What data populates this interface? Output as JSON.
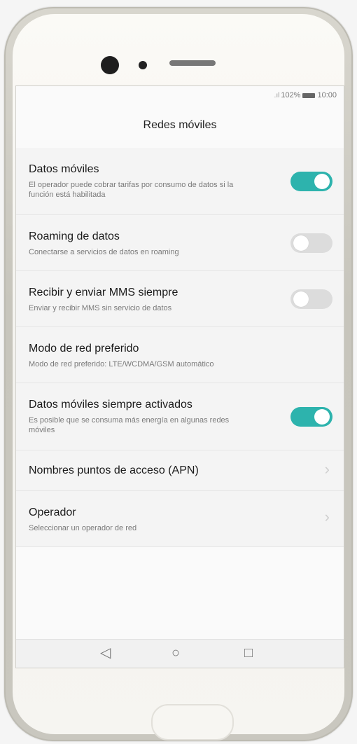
{
  "status_bar": {
    "signal": "…⊿",
    "battery_percent": "102%",
    "time": "10:00"
  },
  "screen_title": "Redes móviles",
  "settings": [
    {
      "title": "Datos móviles",
      "subtitle": "El operador puede cobrar tarifas por consumo de datos si la función está habilitada",
      "toggle": "on"
    },
    {
      "title": "Roaming de datos",
      "subtitle": "Conectarse a servicios de datos en roaming",
      "toggle": "off"
    },
    {
      "title": "Recibir y enviar MMS siempre",
      "subtitle": "Enviar y recibir MMS sin servicio de datos",
      "toggle": "off"
    },
    {
      "title": "Modo de red preferido",
      "subtitle": "Modo de red preferido: LTE/WCDMA/GSM automático"
    },
    {
      "title": "Datos móviles siempre activados",
      "subtitle": "Es posible que se consuma más energía en algunas redes móviles",
      "toggle": "on"
    },
    {
      "title": "Nombres puntos de acceso (APN)",
      "chevron": "›"
    },
    {
      "title": "Operador",
      "subtitle": "Seleccionar un operador de red",
      "chevron": "›"
    }
  ],
  "nav": {
    "back_icon": "◁",
    "home_icon": "○",
    "recents_icon": "□"
  },
  "colors": {
    "accent": "#2db3ad"
  }
}
